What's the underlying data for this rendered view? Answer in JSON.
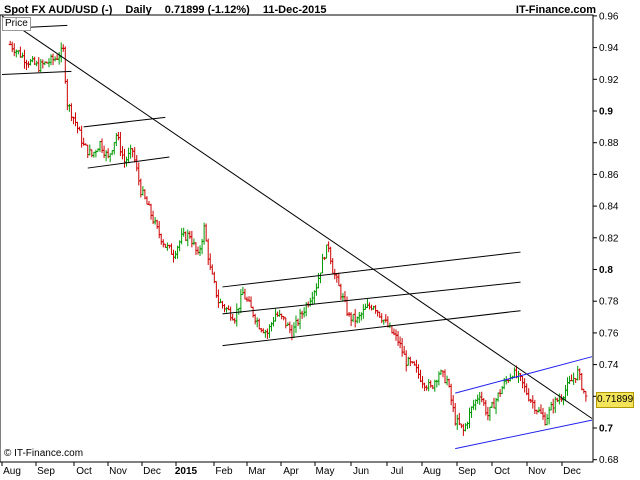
{
  "header": {
    "instrument": "Spot FX AUD/USD (-)",
    "period": "Daily",
    "last_change": "0.71899 (-1.12%)",
    "date": "11-Dec-2015",
    "brand": "IT-Finance.com"
  },
  "price_label": "Price",
  "watermark": "© IT-Finance.com",
  "last_price_badge": "0.71899",
  "colors": {
    "up_bar": "#009a00",
    "down_bar": "#cc0000",
    "trendline": "#000000",
    "channel": "#2222ee",
    "badge": "#f3e45a"
  },
  "chart_data": {
    "type": "ohlc",
    "title": "",
    "xlabel": "",
    "ylabel": "",
    "ylim": [
      0.675,
      0.965
    ],
    "grid": false,
    "x_ticks": [
      "Aug",
      "Sep",
      "Oct",
      "Nov",
      "Dec",
      "2015",
      "Feb",
      "Mar",
      "Apr",
      "May",
      "Jun",
      "Jul",
      "Aug",
      "Sep",
      "Oct",
      "Nov",
      "Dec"
    ],
    "y_ticks": [
      "0.96",
      "0.94",
      "0.92",
      "0.9",
      "0.88",
      "0.86",
      "0.84",
      "0.82",
      "0.8",
      "0.78",
      "0.76",
      "0.74",
      "0.72",
      "0.7",
      "0.68"
    ],
    "y_tick_bold": [
      "0.9",
      "0.8",
      "0.7"
    ],
    "close_path": [
      [
        0,
        0.942
      ],
      [
        8,
        0.932
      ],
      [
        14,
        0.928
      ],
      [
        22,
        0.933
      ],
      [
        26,
        0.938
      ],
      [
        28,
        0.905
      ],
      [
        32,
        0.893
      ],
      [
        36,
        0.878
      ],
      [
        40,
        0.872
      ],
      [
        44,
        0.88
      ],
      [
        48,
        0.87
      ],
      [
        52,
        0.885
      ],
      [
        56,
        0.868
      ],
      [
        60,
        0.875
      ],
      [
        64,
        0.85
      ],
      [
        68,
        0.838
      ],
      [
        72,
        0.825
      ],
      [
        76,
        0.815
      ],
      [
        80,
        0.81
      ],
      [
        84,
        0.82
      ],
      [
        88,
        0.822
      ],
      [
        92,
        0.808
      ],
      [
        95,
        0.826
      ],
      [
        98,
        0.8
      ],
      [
        102,
        0.78
      ],
      [
        106,
        0.775
      ],
      [
        110,
        0.77
      ],
      [
        114,
        0.785
      ],
      [
        118,
        0.775
      ],
      [
        122,
        0.765
      ],
      [
        126,
        0.76
      ],
      [
        130,
        0.772
      ],
      [
        134,
        0.768
      ],
      [
        138,
        0.76
      ],
      [
        142,
        0.77
      ],
      [
        146,
        0.78
      ],
      [
        150,
        0.79
      ],
      [
        152,
        0.8
      ],
      [
        154,
        0.81
      ],
      [
        156,
        0.815
      ],
      [
        158,
        0.8
      ],
      [
        162,
        0.785
      ],
      [
        166,
        0.77
      ],
      [
        170,
        0.768
      ],
      [
        174,
        0.775
      ],
      [
        178,
        0.778
      ],
      [
        182,
        0.77
      ],
      [
        186,
        0.762
      ],
      [
        190,
        0.755
      ],
      [
        194,
        0.742
      ],
      [
        198,
        0.738
      ],
      [
        202,
        0.73
      ],
      [
        206,
        0.725
      ],
      [
        210,
        0.735
      ],
      [
        214,
        0.73
      ],
      [
        218,
        0.705
      ],
      [
        222,
        0.698
      ],
      [
        226,
        0.712
      ],
      [
        230,
        0.722
      ],
      [
        234,
        0.708
      ],
      [
        238,
        0.718
      ],
      [
        242,
        0.728
      ],
      [
        246,
        0.735
      ],
      [
        250,
        0.73
      ],
      [
        254,
        0.72
      ],
      [
        258,
        0.712
      ],
      [
        262,
        0.705
      ],
      [
        266,
        0.715
      ],
      [
        270,
        0.72
      ],
      [
        274,
        0.728
      ],
      [
        278,
        0.735
      ],
      [
        282,
        0.719
      ]
    ],
    "annotations": [
      {
        "kind": "trendline",
        "from": [
          -4,
          0.96
        ],
        "to": [
          285,
          0.706
        ]
      },
      {
        "kind": "trendline",
        "from": [
          -4,
          0.952
        ],
        "to": [
          28,
          0.954
        ]
      },
      {
        "kind": "trendline",
        "from": [
          -4,
          0.923
        ],
        "to": [
          30,
          0.925
        ]
      },
      {
        "kind": "trendline",
        "from": [
          36,
          0.89
        ],
        "to": [
          76,
          0.896
        ]
      },
      {
        "kind": "trendline",
        "from": [
          38,
          0.864
        ],
        "to": [
          78,
          0.871
        ]
      },
      {
        "kind": "trendline",
        "from": [
          104,
          0.789
        ],
        "to": [
          250,
          0.811
        ]
      },
      {
        "kind": "trendline",
        "from": [
          104,
          0.772
        ],
        "to": [
          250,
          0.792
        ]
      },
      {
        "kind": "trendline",
        "from": [
          104,
          0.752
        ],
        "to": [
          250,
          0.774
        ]
      },
      {
        "kind": "channel",
        "from": [
          218,
          0.722
        ],
        "to": [
          285,
          0.745
        ]
      },
      {
        "kind": "channel",
        "from": [
          218,
          0.687
        ],
        "to": [
          285,
          0.705
        ]
      }
    ]
  }
}
